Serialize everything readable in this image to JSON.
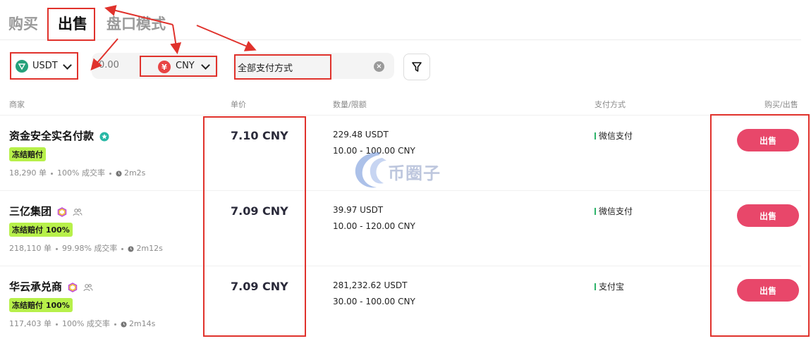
{
  "tabs": [
    {
      "label": "购买"
    },
    {
      "label": "出售"
    },
    {
      "label": "盘口模式"
    }
  ],
  "filters": {
    "crypto": {
      "label": "USDT"
    },
    "amount": {
      "placeholder": "0.00"
    },
    "fiat": {
      "label": "CNY",
      "symbol": "¥"
    },
    "payment": {
      "value": "全部支付方式"
    }
  },
  "table": {
    "headers": {
      "merchant": "商家",
      "price": "单价",
      "quantity": "数量/限额",
      "payment": "支付方式",
      "action": "购买/出售"
    },
    "rows": [
      {
        "merchant": "资金安全实名付款",
        "tag": "冻结赔付",
        "orders": "18,290 单",
        "completion": "100% 成交率",
        "time": "2m2s",
        "price": "7.10 CNY",
        "quantity": "229.48 USDT",
        "limit": "10.00 - 100.00 CNY",
        "payment": "微信支付",
        "action": "出售"
      },
      {
        "merchant": "三亿集团",
        "tag": "冻结赔付 100%",
        "orders": "218,110 单",
        "completion": "99.98% 成交率",
        "time": "2m12s",
        "price": "7.09 CNY",
        "quantity": "39.97 USDT",
        "limit": "10.00 - 120.00 CNY",
        "payment": "微信支付",
        "action": "出售"
      },
      {
        "merchant": "华云承兑商",
        "tag": "冻结赔付 100%",
        "orders": "117,403 单",
        "completion": "100% 成交率",
        "time": "2m14s",
        "price": "7.09 CNY",
        "quantity": "281,232.62 USDT",
        "limit": "30.00 - 100.00 CNY",
        "payment": "支付宝",
        "action": "出售"
      }
    ]
  },
  "watermark": {
    "text": "币圈子"
  },
  "colors": {
    "sell_button": "#e8476a",
    "tag_bg": "#b7f04a",
    "annotation": "#e0322c",
    "usdt": "#26a17b",
    "cny": "#e84545"
  }
}
